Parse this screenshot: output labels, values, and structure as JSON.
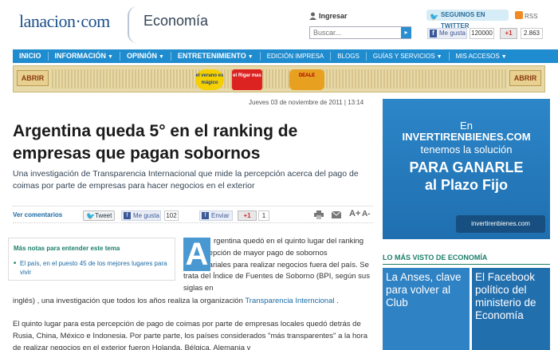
{
  "header": {
    "logo": "lanacion·com",
    "section": "Economía",
    "ingresar": "Ingresar",
    "search_placeholder": "Buscar...",
    "twitter_follow": "SEGUINOS EN TWITTER",
    "rss": "RSS",
    "fb_like": "Me gusta",
    "fb_count": "120000",
    "gplus": "+1",
    "gplus_count": "2.863"
  },
  "nav": {
    "items": [
      {
        "label": "INICIO"
      },
      {
        "label": "INFORMACIÓN"
      },
      {
        "label": "OPINIÓN"
      },
      {
        "label": "ENTRETENIMIENTO"
      },
      {
        "label": "EDICIÓN IMPRESA"
      },
      {
        "label": "BLOGS"
      },
      {
        "label": "GUÍAS Y SERVICIOS"
      },
      {
        "label": "MIS ACCESOS"
      }
    ]
  },
  "ad_banner": {
    "abrir_left": "ABRIR",
    "abrir_right": "ABRIR",
    "logo1": "el verano es mágico",
    "logo2": "el Rigar mas",
    "logo3": "DEALE"
  },
  "article": {
    "date": "Jueves 03 de noviembre de 2011 | 13:14",
    "headline": "Argentina queda 5° en el ranking de empresas que pagan sobornos",
    "subhead": "Una investigación de Transparencia Internacional que mide la percepción acerca del pago de coimas por parte de empresas para hacer negocios en el exterior",
    "dropcap": "A",
    "p1_start": "rgentina quedó en el quinto lugar del ranking de percepción de mayor pago de sobornos empresariales para realizar negocios fuera del país. Se trata del Índice de Fuentes de Soborno (BPI, según sus siglas en",
    "p1_end_prefix": "inglés) , una investigación que todos los años realiza la organización ",
    "p1_link": "Transparencia Interncional",
    "p1_end_suffix": " .",
    "p2": "El quinto lugar para esta percepción de pago de coimas por parte de empresas locales quedó detrás de Rusia, China, México e Indonesia. Por parte parte, los países considerados \"más transparentes\" a la hora de realizar negocios en el exterior fueron Holanda, Bélgica, Alemania y"
  },
  "share": {
    "ver_comentarios": "Ver comentarios",
    "tweet": "Tweet",
    "fb_like": "Me gusta",
    "fb_count": "102",
    "enviar": "Enviar",
    "gplus": "+1",
    "gplus_count": "1",
    "font_up": "A+",
    "font_down": "A-"
  },
  "related": {
    "title": "Más notas para entender este tema",
    "item": "El país, en el puesto 45 de los mejores lugares para vivir"
  },
  "side_ad": {
    "l1": "En",
    "l2": "INVERTIRENBIENES.COM",
    "l3": "tenemos la solución",
    "l4": "PARA GANARLE",
    "l5": "al Plazo Fijo",
    "brand": "invertirenbienes.com"
  },
  "mas_visto": {
    "title": "LO MÁS VISTO DE ECONOMÍA",
    "cards": [
      {
        "text": "La Anses, clave para volver al Club"
      },
      {
        "text": "El Facebook político del ministerio de Economía"
      }
    ]
  },
  "colors": {
    "nav_blue": "#1f8ccf",
    "link_blue": "#1a6aa5",
    "green_accent": "#1a7f6a"
  }
}
